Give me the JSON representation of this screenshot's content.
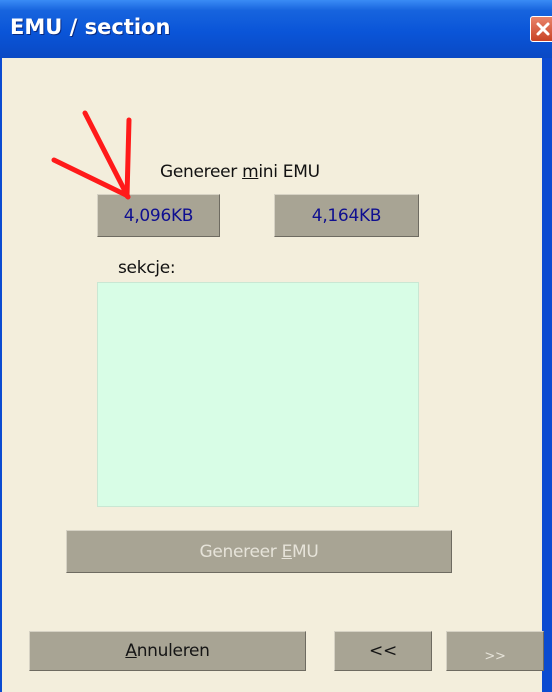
{
  "window": {
    "title": "EMU / section"
  },
  "mini_emu": {
    "label_pre": "Genereer ",
    "label_accel": "m",
    "label_post": "ini EMU",
    "size_button_1": "4,096KB",
    "size_button_2": "4,164KB"
  },
  "sections": {
    "label": "sekcje:",
    "items": []
  },
  "generate_button": {
    "label_pre": "Genereer ",
    "label_accel": "E",
    "label_post": "MU",
    "state": "disabled"
  },
  "footer": {
    "cancel_accel": "A",
    "cancel_rest": "nnuleren",
    "back_label": "<<",
    "next_label": ">>"
  },
  "colors": {
    "titlebar": "#0a55d8",
    "dialog_bg": "#f3eedc",
    "button_face": "#a8a494",
    "listbox_bg": "#d8fde6",
    "annotation_arrow": "#ff1a1a"
  }
}
